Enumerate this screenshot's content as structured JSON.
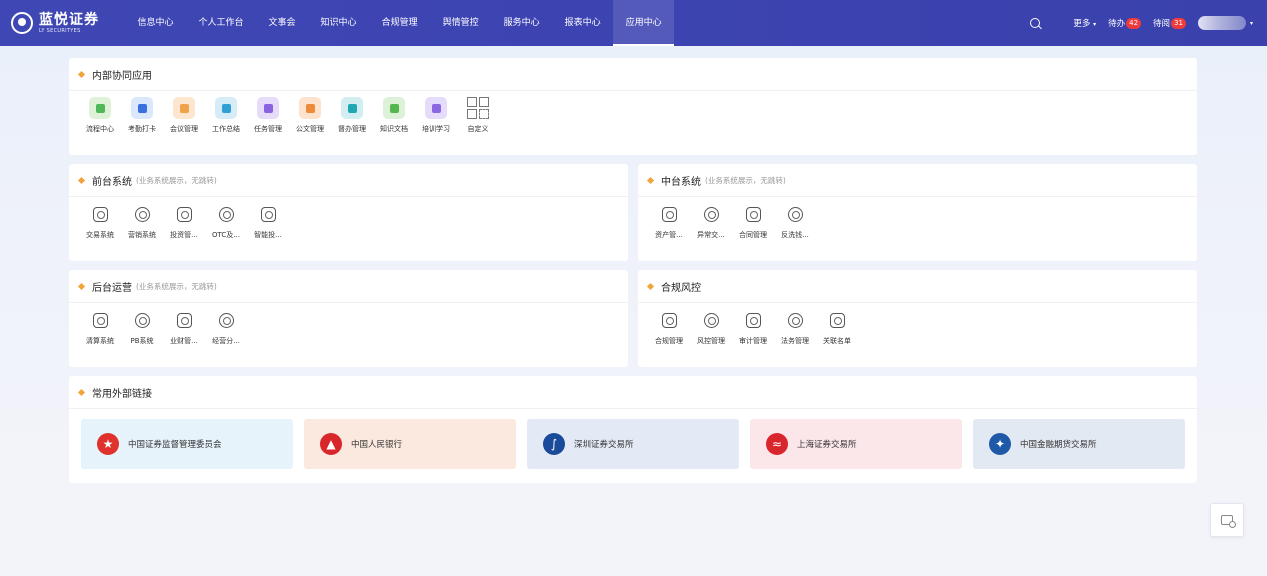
{
  "header": {
    "logo_cn": "蓝悦证券",
    "logo_en": "LY SECURITYES",
    "nav": [
      "信息中心",
      "个人工作台",
      "文事会",
      "知识中心",
      "合规管理",
      "舆情管控",
      "服务中心",
      "报表中心",
      "应用中心"
    ],
    "active_nav": "应用中心",
    "more": "更多",
    "todo_label": "待办",
    "todo_count": "42",
    "toread_label": "待阅",
    "toread_count": "31"
  },
  "internal": {
    "title": "内部协同应用",
    "apps": [
      {
        "label": "流程中心",
        "color": "#dff2d8",
        "inner": "#4fb85a"
      },
      {
        "label": "考勤打卡",
        "color": "#dbe7fb",
        "inner": "#3a6fe0"
      },
      {
        "label": "会议管理",
        "color": "#fde6cf",
        "inner": "#f0a24a"
      },
      {
        "label": "工作总结",
        "color": "#d6ecf7",
        "inner": "#2f9fd4"
      },
      {
        "label": "任务管理",
        "color": "#e6dcf9",
        "inner": "#8a63e0"
      },
      {
        "label": "公文管理",
        "color": "#fde3cd",
        "inner": "#ec8b3a"
      },
      {
        "label": "督办管理",
        "color": "#d3eef1",
        "inner": "#1fa7b4"
      },
      {
        "label": "知识文档",
        "color": "#dcf1d8",
        "inner": "#54b84f"
      },
      {
        "label": "培训学习",
        "color": "#e4dcfa",
        "inner": "#8c67e2"
      }
    ],
    "custom_label": "自定义"
  },
  "front": {
    "title": "前台系统",
    "sub": "(业务系统展示，无跳转)",
    "apps": [
      "交易系统",
      "营销系统",
      "投资管...",
      "OTC及...",
      "智能投..."
    ]
  },
  "middle": {
    "title": "中台系统",
    "sub": "(业务系统展示，无跳转)",
    "apps": [
      "资产管...",
      "异常交...",
      "合同管理",
      "反洗钱..."
    ]
  },
  "back": {
    "title": "后台运营",
    "sub": "(业务系统展示，无跳转)",
    "apps": [
      "清算系统",
      "PB系统",
      "业财管...",
      "经营分..."
    ]
  },
  "risk": {
    "title": "合规风控",
    "apps": [
      "合规管理",
      "风控管理",
      "审计管理",
      "法务管理",
      "关联名单"
    ]
  },
  "external": {
    "title": "常用外部链接",
    "links": [
      {
        "label": "中国证券监督管理委员会",
        "bg": "#e6f3fb",
        "icon_bg": "#e0322c",
        "glyph": "★"
      },
      {
        "label": "中国人民银行",
        "bg": "#fbe9e0",
        "icon_bg": "#d8262a",
        "glyph": "▲"
      },
      {
        "label": "深圳证券交易所",
        "bg": "#e3eaf6",
        "icon_bg": "#1a4a9a",
        "glyph": "∫"
      },
      {
        "label": "上海证券交易所",
        "bg": "#fbe6ea",
        "icon_bg": "#d9262d",
        "glyph": "≈"
      },
      {
        "label": "中国金融期货交易所",
        "bg": "#e3e9f3",
        "icon_bg": "#1f5aa8",
        "glyph": "✦"
      }
    ]
  }
}
